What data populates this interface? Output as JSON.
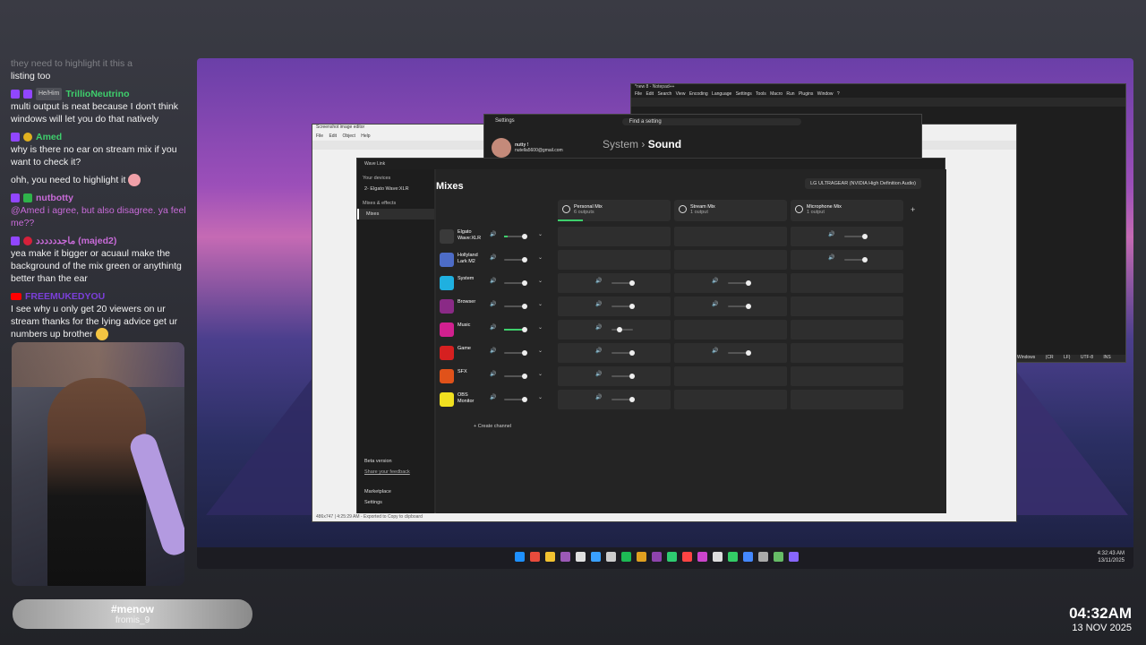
{
  "chat": {
    "top_faded": "they need to highlight it   this a",
    "top_line": "listing too",
    "messages": [
      {
        "user": "TrillioNeutrino",
        "pronoun": "He/Him",
        "color": "#3ecf6c",
        "text": "multi output is neat because I don't think windows will let you do that natively"
      },
      {
        "user": "Amed",
        "pronoun": "",
        "color": "#3ecf6c",
        "text": "why is there no ear on stream mix if you want to check it?"
      },
      {
        "user": "",
        "pronoun": "",
        "color": "#ffffff",
        "text": "ohh, you need to highlight it"
      },
      {
        "user": "nutbotty",
        "pronoun": "",
        "color": "#c86bd8",
        "text": "@Amed i agree, but also disagree. ya feel me??"
      },
      {
        "user": "ماجدددددد (majed2)",
        "pronoun": "",
        "color": "#c86bd8",
        "text": "yea make it bigger or acuaul make the background of the mix green or anythintg better than the ear"
      },
      {
        "user": "FREEMUKEDYOU",
        "pronoun": "",
        "color": "#7b3fd9",
        "text": "I see why u only get 20 viewers on ur stream thanks for the lying advice get ur numbers up brother"
      }
    ]
  },
  "song": {
    "title": "#menow",
    "artist": "fromis_9"
  },
  "clock": {
    "time": "04:32AM",
    "date": "13 NOV 2025"
  },
  "notepad": {
    "title": "*new 8 - Notepad++",
    "menu": "File Edit Search View Encoding Language Settings Tools Macro Run Plugins Window ?",
    "status": "Windows (CR LF)  UTF-8  INS"
  },
  "snipping": {
    "title": "Screenshot image editor",
    "menu": "File Edit Object Help",
    "status": "486x747  |  4:25:29 AM - Exported to Copy to clipboard"
  },
  "settings": {
    "title": "Settings",
    "search_placeholder": "Find a setting",
    "account_name": "nutty !",
    "account_email": "nutella5600@gmail.com",
    "crumb_parent": "System",
    "crumb_current": "Sound"
  },
  "wavelink": {
    "title": "Wave Link",
    "sidebar": {
      "your_devices": "Your devices",
      "device": "2- Elgato Wave:XLR",
      "section": "Mixes & effects",
      "mixes": "Mixes",
      "beta_title": "Beta version",
      "beta_link": "Share your feedback",
      "marketplace": "Marketplace",
      "settings": "Settings"
    },
    "heading": "Mixes",
    "output_device": "LG ULTRAGEAR (NVIDIA High Definition Audio)",
    "mixes": [
      {
        "name": "Personal Mix",
        "sub": "6 outputs"
      },
      {
        "name": "Stream Mix",
        "sub": "1 output"
      },
      {
        "name": "Microphone Mix",
        "sub": "1 output"
      }
    ],
    "channels": [
      {
        "name": "Elgato Wave:XLR",
        "color": "#3a3a3a",
        "level": 0.15
      },
      {
        "name": "Hollyland Lark M2",
        "color": "#4d6cc7",
        "level": 0.0
      },
      {
        "name": "System",
        "color": "#1fb0e0",
        "level": 0.0
      },
      {
        "name": "Browser",
        "color": "#8a2a86",
        "level": 0.0
      },
      {
        "name": "Music",
        "color": "#d1208f",
        "level": 0.85
      },
      {
        "name": "Game",
        "color": "#d62020",
        "level": 0.0
      },
      {
        "name": "SFX",
        "color": "#e0521a",
        "level": 0.0
      },
      {
        "name": "OBS Monitor",
        "color": "#f0e020",
        "level": 0.0
      }
    ],
    "create_channel": "Create channel",
    "icons": {
      "plus": "+",
      "chevron": "⌄",
      "speaker": "🔊",
      "chevron_right": "›"
    }
  },
  "tray": {
    "time": "4:32:43 AM",
    "date": "13/11/2025"
  }
}
